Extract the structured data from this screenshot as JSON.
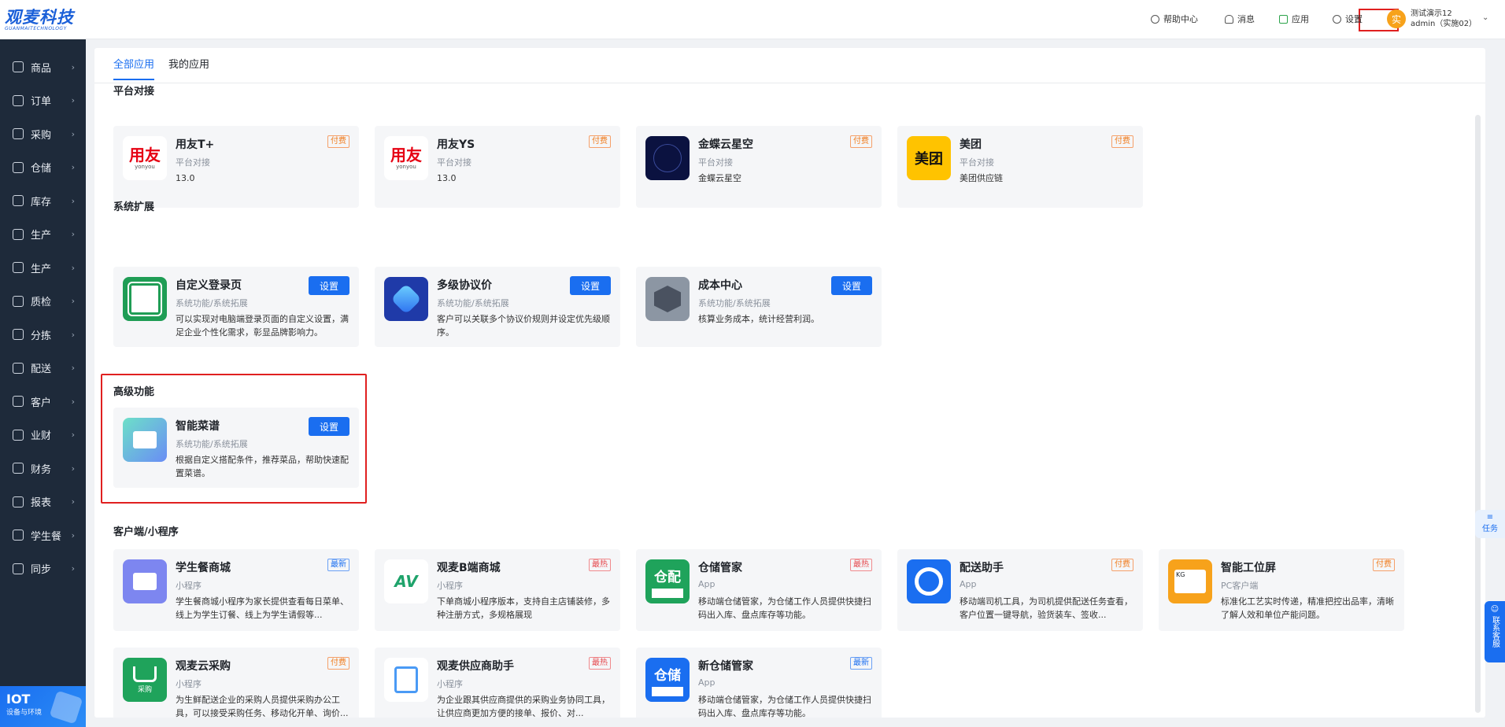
{
  "brand": {
    "logo_main": "观麦科技",
    "logo_sub": "GUANMAITECHNOLOGY"
  },
  "sidebar": {
    "items": [
      {
        "label": "商品"
      },
      {
        "label": "订单"
      },
      {
        "label": "采购"
      },
      {
        "label": "仓储"
      },
      {
        "label": "库存"
      },
      {
        "label": "生产"
      },
      {
        "label": "生产"
      },
      {
        "label": "质检"
      },
      {
        "label": "分拣"
      },
      {
        "label": "配送"
      },
      {
        "label": "客户"
      },
      {
        "label": "业财"
      },
      {
        "label": "财务"
      },
      {
        "label": "报表"
      },
      {
        "label": "学生餐"
      },
      {
        "label": "同步"
      }
    ],
    "iot": {
      "title": "IOT",
      "subtitle": "设备与环境"
    }
  },
  "topbar": {
    "help": "帮助中心",
    "messages": "消息",
    "apps": "应用",
    "settings": "设置",
    "user": {
      "avatar_text": "实",
      "name": "测试演示12",
      "account": "admin（实施02）"
    }
  },
  "tabs": [
    {
      "label": "全部应用"
    },
    {
      "label": "我的应用"
    }
  ],
  "sections": {
    "platform": "平台对接",
    "system": "系统扩展",
    "advanced": "高级功能",
    "client": "客户端/小程序"
  },
  "cards": {
    "yonyou_t": {
      "title": "用友T+",
      "category": "平台对接",
      "desc": "13.0",
      "badge": "付费",
      "icon_text": "用友",
      "icon_sub": "yonyou"
    },
    "yonyou_ys": {
      "title": "用友YS",
      "category": "平台对接",
      "desc": "13.0",
      "badge": "付费",
      "icon_text": "用友",
      "icon_sub": "yonyou"
    },
    "kingdee": {
      "title": "金蝶云星空",
      "category": "平台对接",
      "desc": "金蝶云星空",
      "badge": "付费"
    },
    "meituan": {
      "title": "美团",
      "category": "平台对接",
      "desc": "美团供应链",
      "badge": "付费",
      "icon_text": "美团"
    },
    "login_page": {
      "title": "自定义登录页",
      "category": "系统功能/系统拓展",
      "desc": "可以实现对电脑端登录页面的自定义设置，满足企业个性化需求，彰显品牌影响力。",
      "button": "设置"
    },
    "agreement_price": {
      "title": "多级协议价",
      "category": "系统功能/系统拓展",
      "desc": "客户可以关联多个协议价规则并设定优先级顺序。",
      "button": "设置"
    },
    "cost_center": {
      "title": "成本中心",
      "category": "系统功能/系统拓展",
      "desc": "核算业务成本，统计经营利润。",
      "button": "设置"
    },
    "smart_menu": {
      "title": "智能菜谱",
      "category": "系统功能/系统拓展",
      "desc": "根据自定义搭配条件，推荐菜品，帮助快速配置菜谱。",
      "button": "设置"
    },
    "student_mall": {
      "title": "学生餐商城",
      "category": "小程序",
      "desc": "学生餐商城小程序为家长提供查看每日菜单、线上为学生订餐、线上为学生请假等...",
      "badge": "最新"
    },
    "b2b_mall": {
      "title": "观麦B端商城",
      "category": "小程序",
      "desc": "下单商城小程序版本，支持自主店铺装修，多种注册方式，多规格展现",
      "badge": "最热",
      "icon_text": "AV"
    },
    "warehouse_keeper": {
      "title": "仓储管家",
      "category": "App",
      "desc": "移动端仓储管家，为仓储工作人员提供快捷扫码出入库、盘点库存等功能。",
      "badge": "最热",
      "icon_text": "仓配"
    },
    "delivery_assistant": {
      "title": "配送助手",
      "category": "App",
      "desc": "移动端司机工具，为司机提供配送任务查看，客户位置一键导航，验货装车、签收...",
      "badge": "付费"
    },
    "smart_screen": {
      "title": "智能工位屏",
      "category": "PC客户端",
      "desc": "标准化工艺实时传递，精准把控出品率，清晰了解人效和单位产能问题。",
      "badge": "付费",
      "icon_text": "KG"
    },
    "cloud_purchase": {
      "title": "观麦云采购",
      "category": "小程序",
      "desc": "为生鲜配送企业的采购人员提供采购办公工具，可以接受采购任务、移动化开单、询价...",
      "badge": "付费",
      "icon_text": "采购"
    },
    "supplier_assistant": {
      "title": "观麦供应商助手",
      "category": "小程序",
      "desc": "为企业跟其供应商提供的采购业务协同工具，让供应商更加方便的接单、报价、对...",
      "badge": "最热"
    },
    "new_warehouse": {
      "title": "新仓储管家",
      "category": "App",
      "desc": "移动端仓储管家，为仓储工作人员提供快捷扫码出入库、盘点库存等功能。",
      "badge": "最新",
      "icon_text": "仓储"
    }
  },
  "floats": {
    "task": "任务",
    "service": "联系客服"
  },
  "colors": {
    "primary": "#1a6ef0",
    "sidebar_bg": "#1e2a3a",
    "highlight": "#e02020",
    "badge_pay": "#f07a1a",
    "badge_hot": "#e5484d"
  }
}
